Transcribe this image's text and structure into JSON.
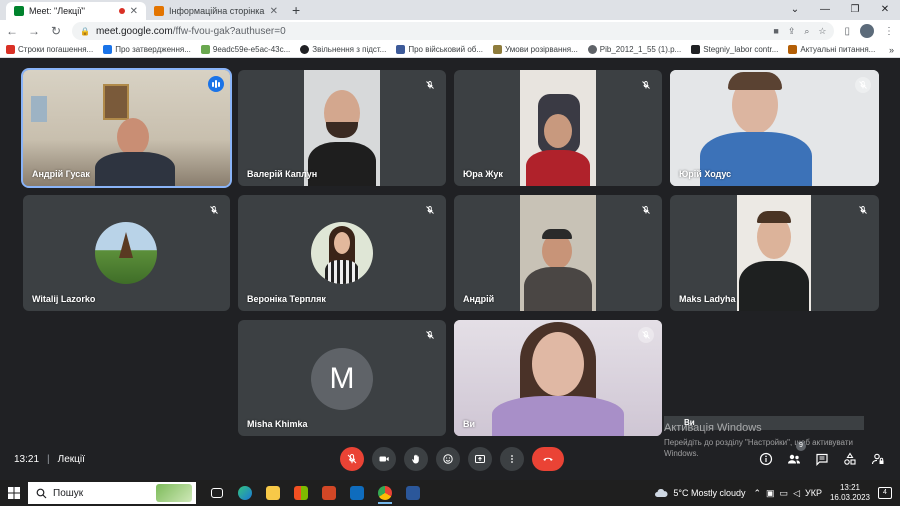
{
  "browser": {
    "tabs": [
      {
        "label": "Meet: \"Лекції\"",
        "active": true
      },
      {
        "label": "Інформаційна сторінка",
        "active": false
      }
    ],
    "url_host": "meet.google.com",
    "url_path": "/ffw-fvou-gak?authuser=0",
    "bookmarks": [
      "Строки погашення...",
      "Про затвердження...",
      "9eadc59e-e5ac-43c...",
      "Звільнення з підст...",
      "Про військовий об...",
      "Умови розірвання...",
      "Pib_2012_1_55 (1).p...",
      "Stegniy_labor contr...",
      "Актуальні питання..."
    ]
  },
  "participants": [
    {
      "name": "Андрій Гусак",
      "muted": false,
      "speaking": true
    },
    {
      "name": "Валерій Каплун",
      "muted": true
    },
    {
      "name": "Юра Жук",
      "muted": true
    },
    {
      "name": "Юрій Ходус",
      "muted": true
    },
    {
      "name": "Witalij Lazorko",
      "muted": true
    },
    {
      "name": "Вероніка Терпляк",
      "muted": true
    },
    {
      "name": "Андрій",
      "muted": true
    },
    {
      "name": "Maks Ladyha",
      "muted": true
    },
    {
      "name": "Misha Khimka",
      "muted": true,
      "initial": "M"
    },
    {
      "name": "Ви",
      "muted": true
    }
  ],
  "self_label_overlay": "Ви",
  "meeting": {
    "time": "13:21",
    "separator": "|",
    "title": "Лекції"
  },
  "people_count": "9",
  "watermark": {
    "title": "Активація Windows",
    "text": "Перейдіть до розділу \"Настройки\", щоб активувати Windows."
  },
  "taskbar": {
    "search_placeholder": "Пошук",
    "weather": "5°C  Mostly cloudy",
    "language": "УКР",
    "time": "13:21",
    "date": "16.03.2023",
    "notifications": "4"
  },
  "colors": {
    "meet_bg": "#202124",
    "tile_bg": "#3c4043",
    "end_call": "#ea4335",
    "speaking": "#1a73e8"
  }
}
